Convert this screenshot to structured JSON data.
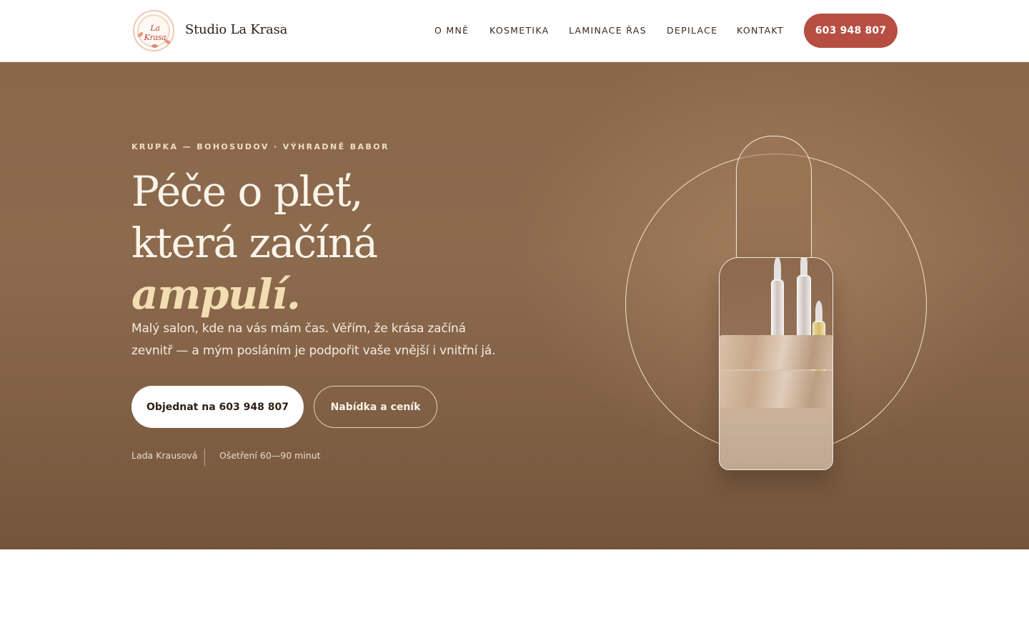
{
  "header": {
    "logo_text": "La Krasa",
    "brand": "Studio La Krasa",
    "nav": [
      "O MNĚ",
      "KOSMETIKA",
      "LAMINACE ŘAS",
      "DEPILACE",
      "KONTAKT"
    ],
    "phone": "603 948 807"
  },
  "hero": {
    "eyebrow": "KRUPKA — BOHOSUDOV · VÝHRADNĚ BABOR",
    "headline_line1": "Péče o pleť,",
    "headline_line2": "která začíná",
    "headline_accent": "ampulí.",
    "lead": "Malý salon, kde na vás mám čas. Věřím, že krása začíná zevnitř — a mým posláním je podpořit vaše vnější i vnitřní já.",
    "cta_primary": "Objednat na 603 948 807",
    "cta_secondary": "Nabídka a ceník",
    "meta_name": "Lada Krausová",
    "meta_duration": "Ošetření 60—90 minut"
  },
  "colors": {
    "accent": "#b64e42",
    "hero_bg": "#8a6749",
    "headline_accent": "#f3ddb2"
  },
  "icons": {
    "logo": "floral-wreath-logo",
    "illustration": "serum-ampoule-bottle"
  }
}
